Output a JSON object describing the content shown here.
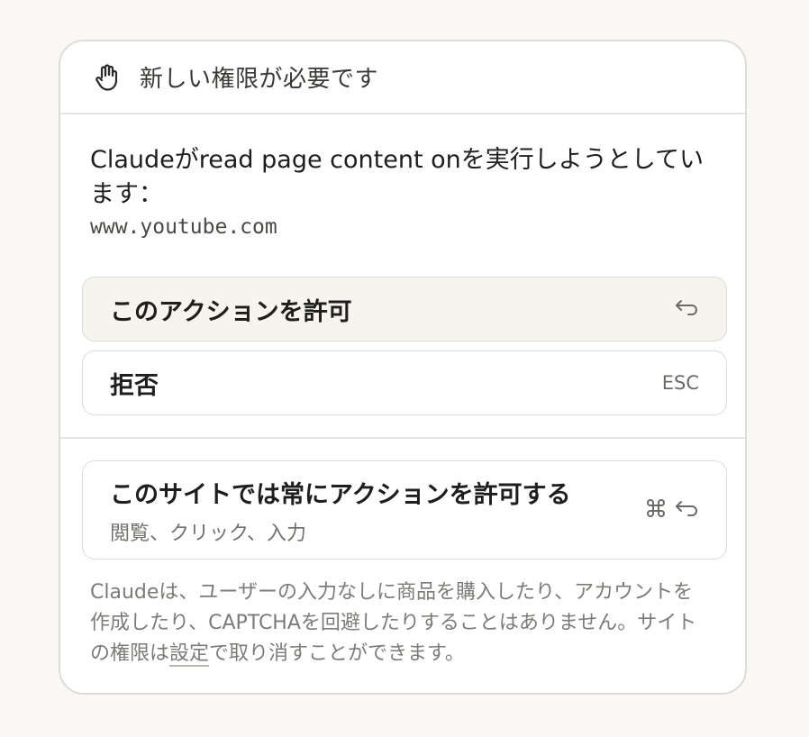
{
  "header": {
    "title": "新しい権限が必要です",
    "icon": "hand-icon"
  },
  "request": {
    "message": "Claudeがread page content onを実行しようとしています：",
    "domain": "www.youtube.com"
  },
  "actions": {
    "allow_label": "このアクションを許可",
    "allow_shortcut_icon": "return-icon",
    "deny_label": "拒否",
    "deny_shortcut": "ESC",
    "always_label": "このサイトでは常にアクションを許可する",
    "always_sub": "閲覧、クリック、入力",
    "always_shortcut_icons": [
      "command-icon",
      "return-icon"
    ]
  },
  "footer": {
    "text_before": "Claudeは、ユーザーの入力なしに商品を購入したり、アカウントを作成したり、CAPTCHAを回避したりすることはありません。サイトの権限は",
    "link": "設定",
    "text_after": "で取り消すことができます。"
  }
}
